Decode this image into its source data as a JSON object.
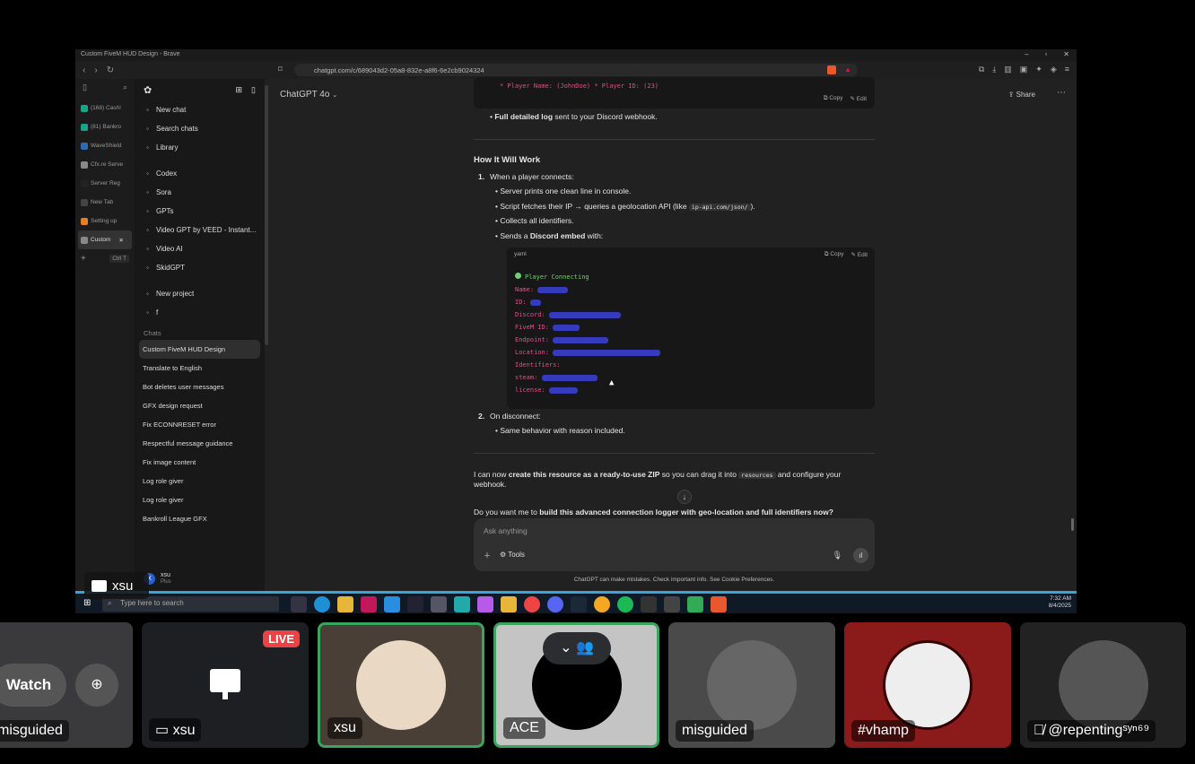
{
  "browser": {
    "title": "Custom FiveM HUD Design - Brave",
    "url": "chatgpt.com/c/689043d2-05a8-832e-a8f6-6e2cb9024324",
    "vertical_tabs": [
      {
        "label": "(168) Cash!",
        "color": "#17a589"
      },
      {
        "label": "(81) Bankro",
        "color": "#17a589"
      },
      {
        "label": "WaveShield",
        "color": "#2b6cb0"
      },
      {
        "label": "Cfx.re Serve",
        "color": "#888888"
      },
      {
        "label": "Server Reg",
        "color": "#222222"
      },
      {
        "label": "New Tab",
        "color": "#444444"
      },
      {
        "label": "Setting up",
        "color": "#e67e22"
      },
      {
        "label": "Custom",
        "color": "#888888"
      }
    ],
    "new_tab_shortcut": "Ctrl T"
  },
  "sidebar": {
    "items": [
      {
        "label": "New chat",
        "icon": "edit-icon"
      },
      {
        "label": "Search chats",
        "icon": "search-icon"
      },
      {
        "label": "Library",
        "icon": "library-icon"
      }
    ],
    "tools": [
      {
        "label": "Codex",
        "icon": "codex-icon"
      },
      {
        "label": "Sora",
        "icon": "sora-icon"
      },
      {
        "label": "GPTs",
        "icon": "grid-icon"
      },
      {
        "label": "Video GPT by VEED - Instant...",
        "icon": "veed-icon"
      },
      {
        "label": "Video AI",
        "icon": "video-ai-icon"
      },
      {
        "label": "SkidGPT",
        "icon": "gpt-icon"
      }
    ],
    "projects": [
      {
        "label": "New project",
        "icon": "folder-plus-icon"
      },
      {
        "label": "f",
        "icon": "folder-icon"
      }
    ],
    "chats_label": "Chats",
    "chats": [
      "Custom FiveM HUD Design",
      "Translate to English",
      "Bot deletes user messages",
      "GFX design request",
      "Fix ECONNRESET error",
      "Respectful message guidance",
      "Fix image content",
      "Log role giver",
      "Log role giver",
      "Bankroll League GFX"
    ],
    "user": {
      "name": "xsu",
      "plan": "Plus",
      "initial": "X"
    }
  },
  "header": {
    "model": "ChatGPT 4o",
    "share": "Share"
  },
  "message": {
    "top_code_line": "* Player Name: (JohnDoe) * Player ID: (23)",
    "copy": "Copy",
    "edit": "Edit",
    "log_bold": "Full detailed log",
    "log_rest": " sent to your Discord webhook.",
    "section_title": "How It Will Work",
    "step1_num": "1.",
    "step1": "When a player connects:",
    "step1_bullets": [
      "Server prints one clean line in console.",
      "Collects all identifiers."
    ],
    "bullet_script_pre": "Script fetches their IP → queries a geolocation API (like ",
    "bullet_script_code": "ip-api.com/json/",
    "bullet_script_post": ").",
    "bullet_embed_pre": "Sends a ",
    "bullet_embed_bold": "Discord embed",
    "bullet_embed_post": " with:",
    "code_lang": "yaml",
    "code_title": "Player Connecting",
    "code_fields": [
      "Name:",
      "ID:",
      "Discord:",
      "FiveM ID:",
      "Endpoint:",
      "Location:",
      "Identifiers:",
      "steam:",
      "license:"
    ],
    "step2_num": "2.",
    "step2": "On disconnect:",
    "step2_bullet": "Same behavior with reason included.",
    "para1_pre": "I can now ",
    "para1_bold": "create this resource as a ready-to-use ZIP",
    "para1_mid": " so you can drag it into ",
    "para1_code": "resources",
    "para1_post": " and configure your webhook.",
    "para2_pre": "Do you want me to ",
    "para2_bold": "build this advanced connection logger with geo-location and full identifiers now?"
  },
  "composer": {
    "placeholder": "Ask anything",
    "tools": "Tools"
  },
  "footnote": "ChatGPT can make mistakes. Check important info. See Cookie Preferences.",
  "taskbar": {
    "search_placeholder": "Type here to search",
    "time": "7:32 AM",
    "date": "8/4/2025"
  },
  "stream_overlay": {
    "label": "xsu"
  },
  "call_tiles": [
    {
      "name": "misguided",
      "button": "Watch"
    },
    {
      "name": "xsu",
      "badge": "LIVE"
    },
    {
      "name": "xsu"
    },
    {
      "name": "ACE"
    },
    {
      "name": "misguided"
    },
    {
      "name": "#vhamp"
    },
    {
      "name": "@repentingˢʸⁿ⁶⁹"
    }
  ]
}
